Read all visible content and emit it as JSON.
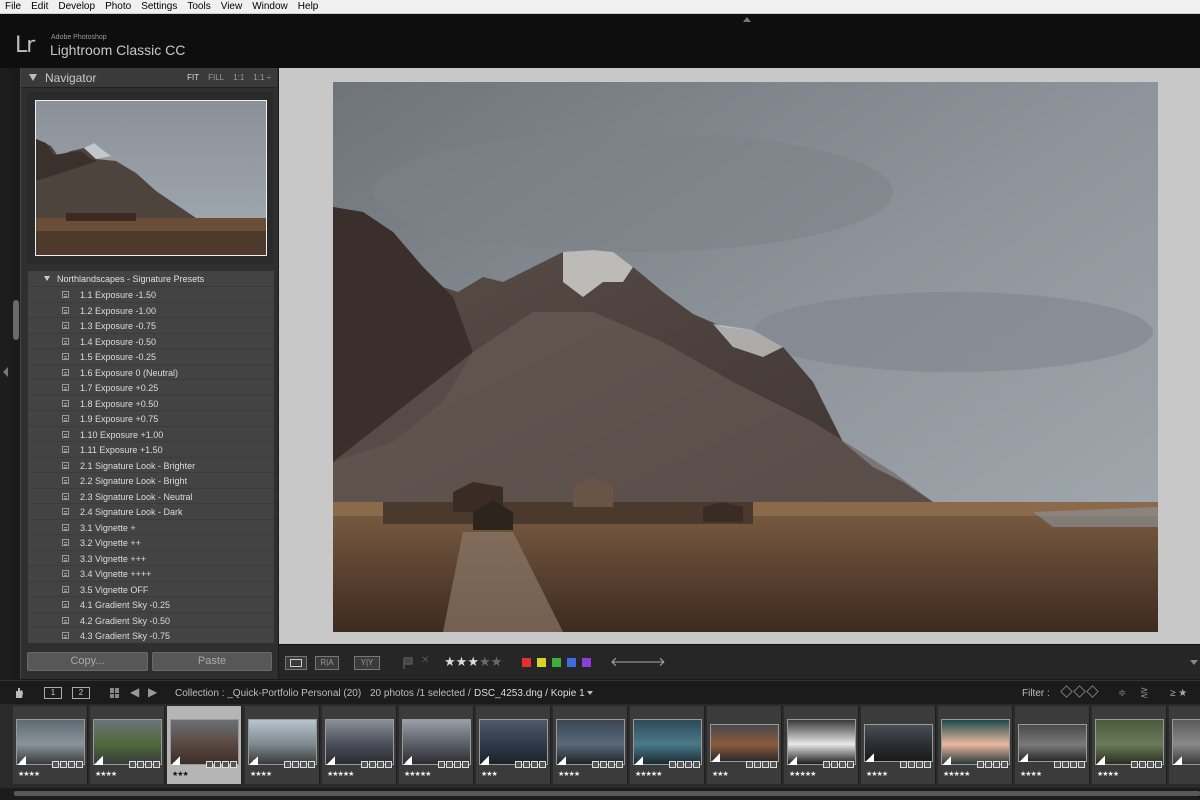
{
  "menu": [
    "File",
    "Edit",
    "Develop",
    "Photo",
    "Settings",
    "Tools",
    "View",
    "Window",
    "Help"
  ],
  "identity": {
    "logo": "Lr",
    "small": "Adobe Photoshop",
    "big": "Lightroom Classic CC"
  },
  "navigator": {
    "title": "Navigator",
    "modes": [
      "FIT",
      "FILL",
      "1:1",
      "1:1 ÷"
    ]
  },
  "presets": {
    "group": "Northlandscapes - Signature Presets",
    "items": [
      "1.1 Exposure -1.50",
      "1.2 Exposure -1.00",
      "1.3 Exposure -0.75",
      "1.4 Exposure -0.50",
      "1.5 Exposure -0.25",
      "1.6 Exposure 0 (Neutral)",
      "1.7 Exposure +0.25",
      "1.8 Exposure +0.50",
      "1.9 Exposure +0.75",
      "1.10 Exposure +1.00",
      "1.11 Exposure +1.50",
      "2.1 Signature Look - Brighter",
      "2.2 Signature Look - Bright",
      "2.3 Signature Look - Neutral",
      "2.4 Signature Look - Dark",
      "3.1 Vignette +",
      "3.2 Vignette ++",
      "3.3 Vignette +++",
      "3.4 Vignette ++++",
      "3.5 Vignette OFF",
      "4.1 Gradient Sky -0.25",
      "4.2 Gradient Sky -0.50",
      "4.3 Gradient Sky -0.75"
    ]
  },
  "buttons": {
    "copy": "Copy...",
    "paste": "Paste"
  },
  "toolbar": {
    "rating": 3,
    "max_rating": 5,
    "colors": [
      "#e03030",
      "#d8d420",
      "#3ab03a",
      "#3a6ee0",
      "#8a40d8"
    ],
    "view_labels": [
      "R|A",
      "Y|Y"
    ]
  },
  "filmstrip_header": {
    "page1": "1",
    "page2": "2",
    "collection": "Collection : _Quick-Portfolio Personal (20)",
    "count": "20 photos /1 selected /",
    "filename": "DSC_4253.dng / Kopie 1",
    "filter_label": "Filter :"
  },
  "filmstrip": [
    {
      "rating": "★★★★",
      "colors": [
        "#5e6a72",
        "#8a949a",
        "#3a3a3a"
      ]
    },
    {
      "rating": "★★★★",
      "colors": [
        "#6c7478",
        "#4e6a3a",
        "#3a3a3a"
      ]
    },
    {
      "rating": "★★★",
      "colors": [
        "#6a7076",
        "#5b4840",
        "#3a2e28"
      ],
      "selected": true
    },
    {
      "rating": "★★★★",
      "colors": [
        "#b8c4cc",
        "#7e8a90",
        "#3a3a3a"
      ]
    },
    {
      "rating": "★★★★★",
      "colors": [
        "#8a8e96",
        "#4a4e58",
        "#2a2c30"
      ]
    },
    {
      "rating": "★★★★★",
      "colors": [
        "#9aa0a8",
        "#5a5e66",
        "#2c2c30"
      ]
    },
    {
      "rating": "★★★",
      "colors": [
        "#4e5a6a",
        "#2e3a4a",
        "#1e2228"
      ]
    },
    {
      "rating": "★★★★",
      "colors": [
        "#3a4654",
        "#5a6878",
        "#1e2428"
      ]
    },
    {
      "rating": "★★★★★",
      "colors": [
        "#2e4a5a",
        "#4a7a8a",
        "#1a2a30"
      ]
    },
    {
      "rating": "★★★",
      "colors": [
        "#4a4a4e",
        "#8a5a3a",
        "#2a2a2a"
      ]
    },
    {
      "rating": "★★★★★",
      "colors": [
        "#3a3a3a",
        "#e8e8e8",
        "#1e1e1e"
      ]
    },
    {
      "rating": "★★★★",
      "colors": [
        "#4a4e54",
        "#2a2e34",
        "#1a1a1a"
      ]
    },
    {
      "rating": "★★★★★",
      "colors": [
        "#1e4a4a",
        "#e8b8a0",
        "#2a3a3a"
      ]
    },
    {
      "rating": "★★★★",
      "colors": [
        "#4a4a4a",
        "#7a7a7a",
        "#2a2a2a"
      ]
    },
    {
      "rating": "★★★★",
      "colors": [
        "#4a5a3a",
        "#6a7a5a",
        "#2a3020"
      ]
    },
    {
      "rating": "",
      "colors": [
        "#5a5a5a",
        "#8a8a8a",
        "#3a3a3a"
      ]
    }
  ]
}
